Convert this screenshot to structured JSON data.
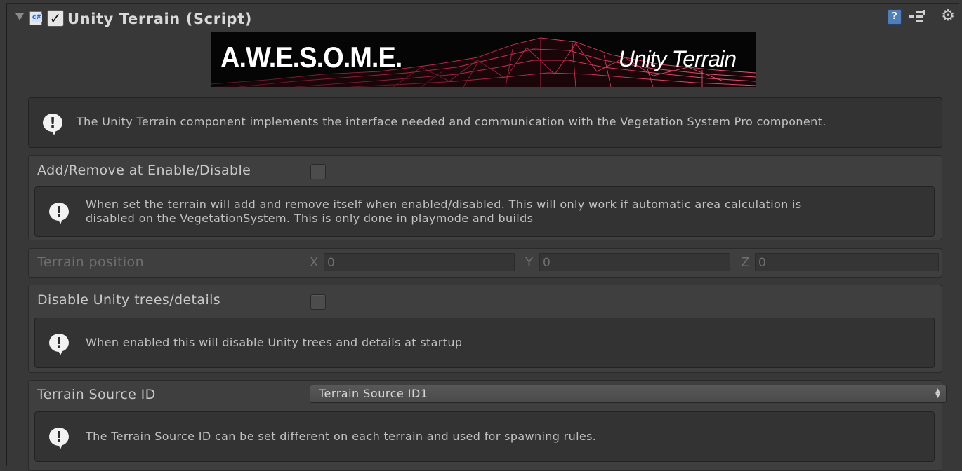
{
  "component": {
    "title": "Unity Terrain (Script)",
    "enabled": true,
    "icons": [
      "foldout-arrow-icon",
      "script-icon",
      "help-icon",
      "preset-icon",
      "gear-icon"
    ]
  },
  "banner": {
    "left_text": "A.W.E.S.O.M.E.",
    "right_text": "Unity Terrain"
  },
  "intro_help": "The Unity Terrain component implements the interface needed and communication with the Vegetation System Pro component.",
  "add_remove": {
    "label": "Add/Remove at Enable/Disable",
    "checked": false,
    "help_line1": "When set the terrain will add and remove itself when enabled/disabled. This will only work if automatic area calculation is",
    "help_line2": "disabled on the VegetationSystem. This is only done in playmode and builds"
  },
  "terrain_position": {
    "label": "Terrain position",
    "x_label": "X",
    "x_value": "0",
    "y_label": "Y",
    "y_value": "0",
    "z_label": "Z",
    "z_value": "0"
  },
  "disable_trees": {
    "label": "Disable Unity trees/details",
    "checked": false,
    "help": "When enabled this will disable Unity trees and details at startup"
  },
  "terrain_source": {
    "label": "Terrain Source ID",
    "selected": "Terrain Source ID1",
    "help": "The Terrain Source ID can be set different on each terrain and used for spawning rules."
  },
  "colors": {
    "background": "#383838",
    "section": "#3f3f3f",
    "help_box": "#333333",
    "banner_accent": "#e0335a"
  }
}
